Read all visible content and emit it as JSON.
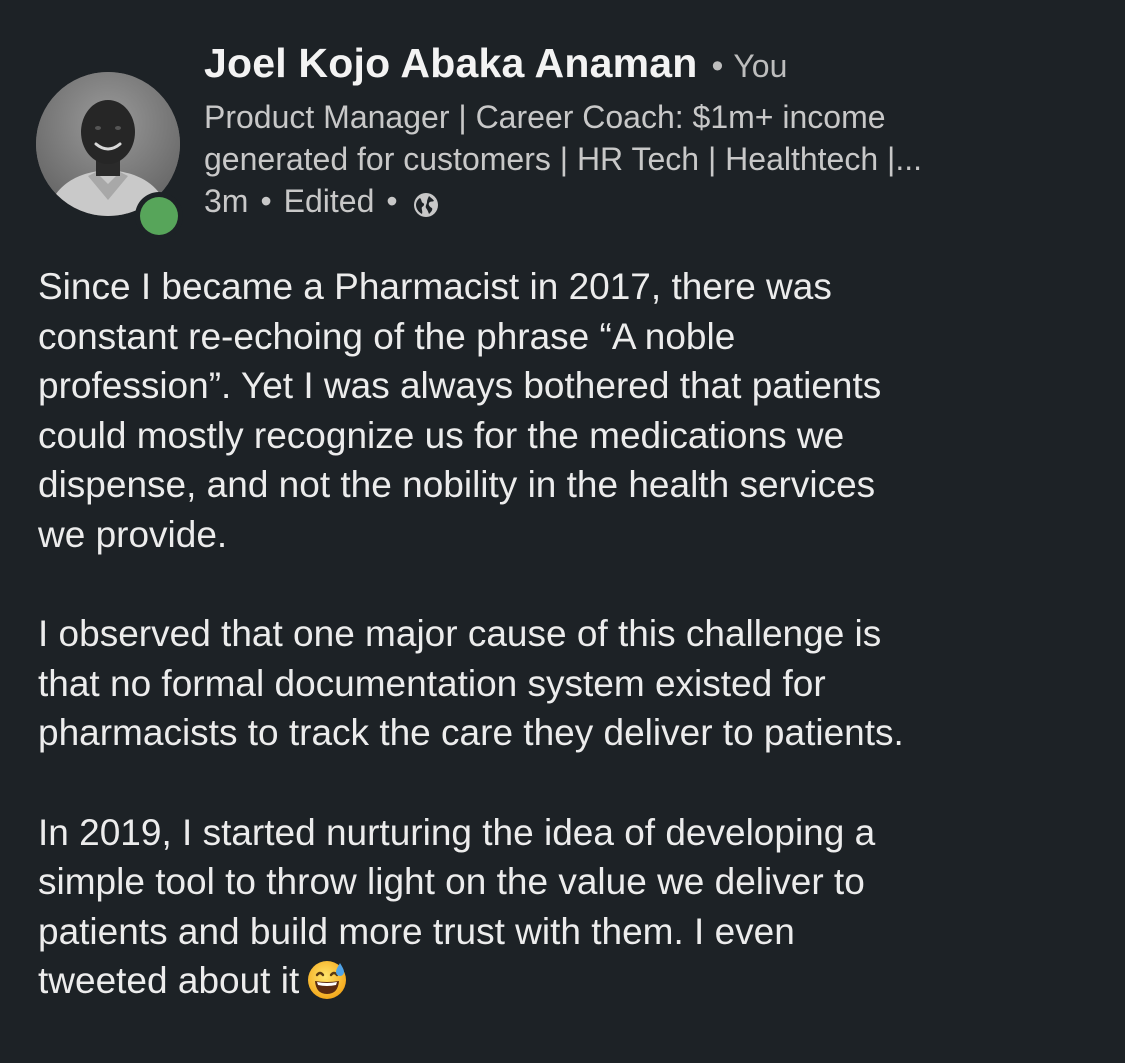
{
  "author": {
    "name": "Joel Kojo Abaka Anaman",
    "separator": "•",
    "badge": "You",
    "avatar_icon": "profile-photo",
    "presence_color": "#57a55a"
  },
  "headline": {
    "line1": "Product Manager | Career Coach: $1m+ income",
    "line2": "generated for customers | HR Tech | Healthtech |..."
  },
  "post_meta": {
    "time": "3m",
    "dot1": "•",
    "edited": "Edited",
    "dot2": "•",
    "visibility_icon": "globe-icon"
  },
  "post_body": {
    "paragraph1": [
      "Since I became a Pharmacist in 2017, there was",
      "constant re-echoing of the phrase “A noble",
      "profession”. Yet I was always bothered that patients",
      "could mostly recognize us for the medications we",
      "dispense, and not the nobility in the health services",
      "we provide."
    ],
    "paragraph2": [
      "I observed that one major cause of this challenge is",
      "that no formal documentation system existed for",
      "pharmacists to track the care they deliver to patients."
    ],
    "paragraph3": [
      "In 2019, I started nurturing the idea of developing a",
      "simple tool to throw light on the value we deliver to",
      "patients and build more trust with them. I even",
      "tweeted about it"
    ],
    "trailing_emoji": "grinning-face-with-sweat-emoji"
  },
  "colors": {
    "background": "#1d2226",
    "text_primary": "#ececec",
    "text_secondary": "#c8c8c8"
  }
}
